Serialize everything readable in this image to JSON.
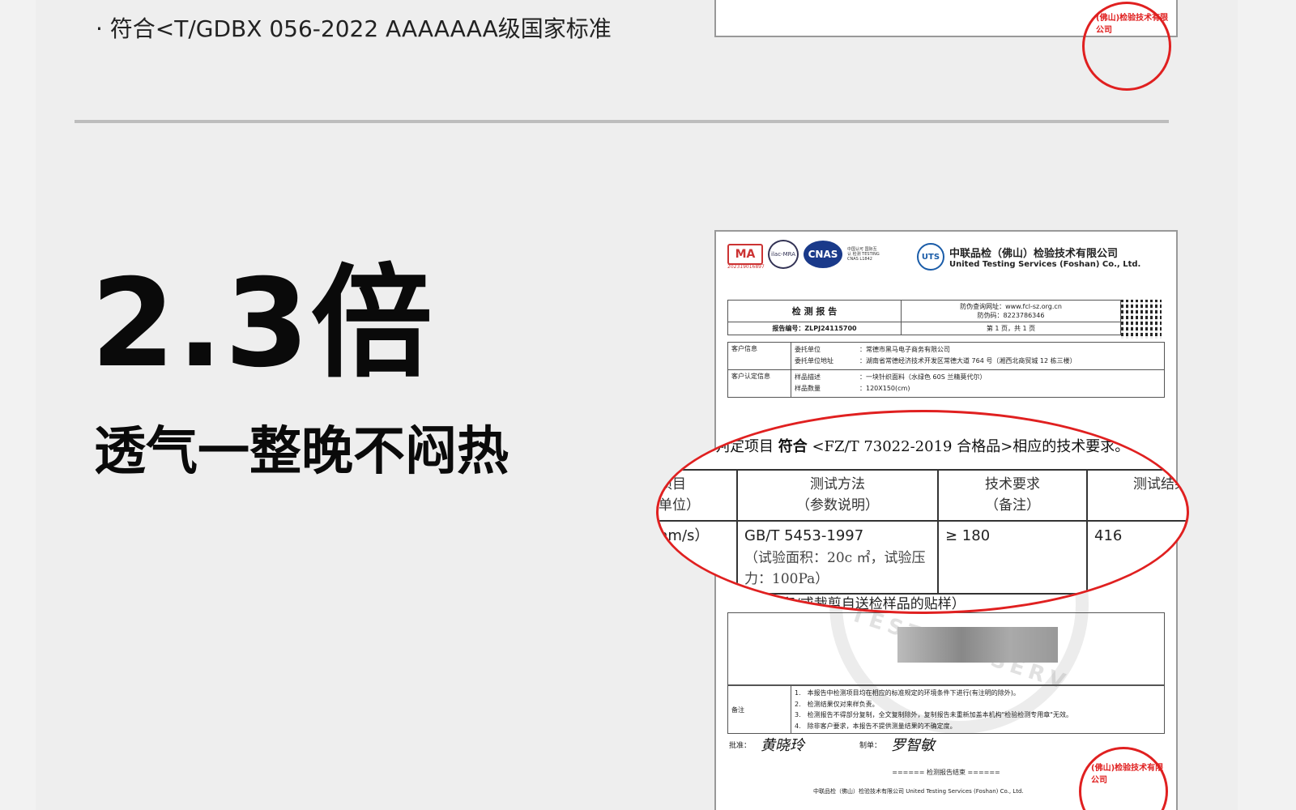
{
  "standard_line": "· 符合<T/GDBX 056-2022 AAAAAAA级国家标准",
  "headline": "2.3倍",
  "subheadline": "透气一整晚不闷热",
  "colors": {
    "accent": "#e02020",
    "text": "#0a0a0a",
    "panel": "#eeeeee"
  },
  "report": {
    "cma_label": "MA",
    "cma_number": "202319016897",
    "ilac_label": "ilac-MRA",
    "cnas_label": "CNAS",
    "cnas_text": "中国认可 国际互认 检测 TESTING CNAS L1842",
    "uts_label": "UTS",
    "company_cn": "中联品检（佛山）检验技术有限公司",
    "company_en": "United Testing Services (Foshan) Co., Ltd.",
    "title": "检 测 报 告",
    "verify_site": "防伪查询网址：www.fcl-sz.org.cn",
    "verify_code": "防伪码：8223786346",
    "report_no": "报告编号：ZLPJ24115700",
    "page_info": "第 1 页，共 1 页",
    "client_info_label": "客户信息",
    "client_unit_label": "委托单位",
    "client_unit": "：常德市黑马电子商务有限公司",
    "client_addr_label": "委托单位地址",
    "client_addr": "：湖南省常德经济技术开发区常德大道 764 号（湘西北商贸城 12 栋三楼）",
    "sample_info_label": "客户认定信息",
    "sample_desc_label": "样品描述",
    "sample_desc": "：一块针织面料（水绿色 60S 兰精莫代尔）",
    "sample_qty_label": "样品数量",
    "sample_qty": "：120X150(cm)",
    "notes_label": "备注",
    "notes": [
      "1.　本报告中检测项目均在相应的标准规定的环境条件下进行(有注明的除外)。",
      "2.　检测结果仅对来样负责。",
      "3.　检测报告不得部分复制，全文复制除外，复制报告未重新加盖本机构\"检验检测专用章\"无效。",
      "4.　除非客户要求，本报告不提供测量结果的不确定度。"
    ],
    "approver_label": "批准：",
    "approver_sig": "黄晓玲",
    "maker_label": "制单：",
    "maker_sig": "罗智敏",
    "end_text": "======  检测报告结束  ======",
    "footer": "中联品检（佛山）检验技术有限公司  United Testing Services (Foshan) Co., Ltd.",
    "stamp_text": "(佛山)检验技术有限公司",
    "watermark": "TESTING SERV"
  },
  "zoom": {
    "head_prefix": "要求判定项目 ",
    "head_bold": "符合",
    "head_rest": " <FZ/T 73022-2019 合格品>相应的技术要求。",
    "col_item": "项目",
    "col_item_unit": "单位）",
    "col_method": "测试方法",
    "col_method_note": "（参数说明）",
    "col_req": "技术要求",
    "col_req_note": "（备注）",
    "col_result": "测试结果",
    "row_unit": "nm/s）",
    "row_method": "GB/T 5453-1997",
    "row_method_note": "（试验面积：20c ㎡，试验压力：100Pa）",
    "row_req": "≥ 180",
    "row_result": "416",
    "foot": "品的照片呈现和/或裁剪自送检样品的贴样）"
  }
}
